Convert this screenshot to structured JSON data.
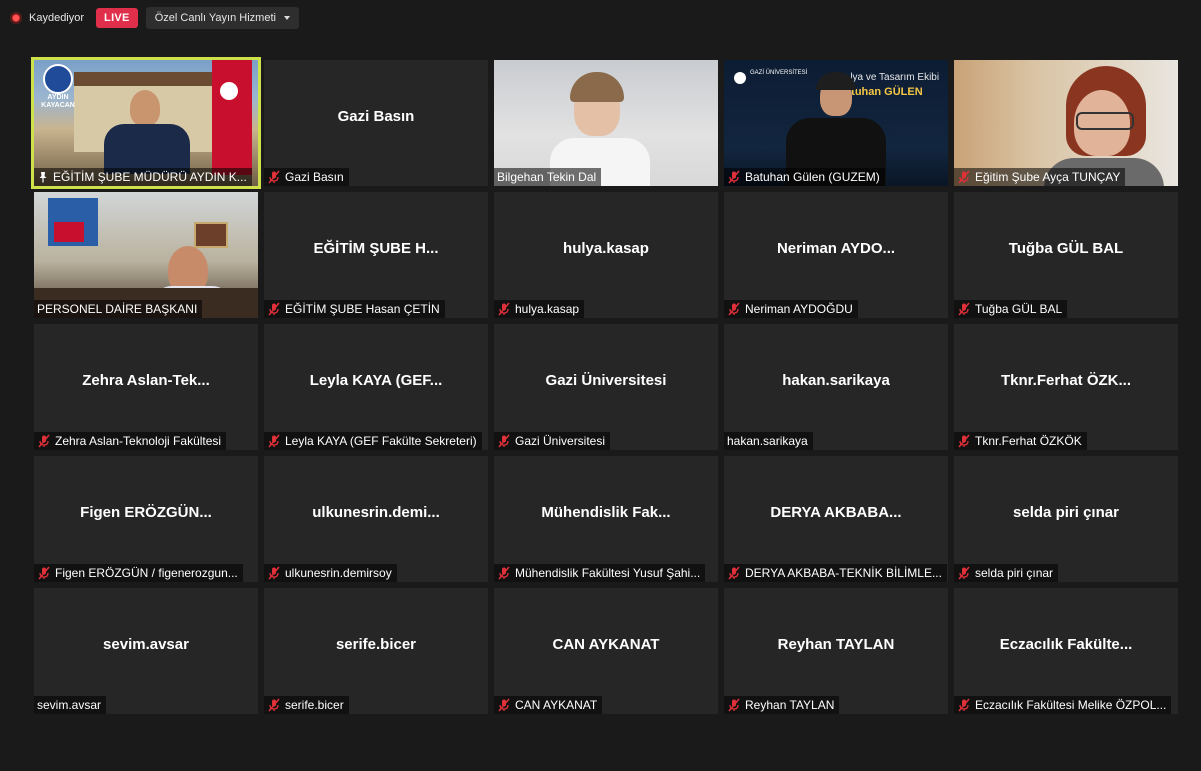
{
  "topbar": {
    "recording_label": "Kaydediyor",
    "live_label": "LIVE",
    "stream_service": "Özel Canlı Yayın Hizmeti"
  },
  "tiles": [
    {
      "name": "",
      "label": "EĞİTİM ŞUBE MÜDÜRÜ AYDIN K...",
      "video": true,
      "muted": false,
      "pinned": true,
      "active": true,
      "logo_text": "AYDIN KAYACAN"
    },
    {
      "name": "Gazi Basın",
      "label": "Gazi Basın",
      "video": false,
      "muted": true
    },
    {
      "name": "",
      "label": "Bilgehan Tekin Dal",
      "video": true,
      "muted": false
    },
    {
      "name": "",
      "label": "Batuhan Gülen (GUZEM)",
      "video": true,
      "muted": true,
      "banner_text": "...lya ve Tasarım Ekibi",
      "banner_name": "...tuhan GÜLEN",
      "banner_org": "GAZİ ÜNİVERSİTESİ"
    },
    {
      "name": "",
      "label": "Eğitim Şube Ayça TUNÇAY",
      "video": true,
      "muted": true
    },
    {
      "name": "",
      "label": "PERSONEL DAİRE BAŞKANI",
      "video": true,
      "muted": false
    },
    {
      "name": "EĞİTİM ŞUBE H...",
      "label": "EĞİTİM ŞUBE Hasan ÇETİN",
      "video": false,
      "muted": true
    },
    {
      "name": "hulya.kasap",
      "label": "hulya.kasap",
      "video": false,
      "muted": true
    },
    {
      "name": "Neriman  AYDO...",
      "label": "Neriman AYDOĞDU",
      "video": false,
      "muted": true
    },
    {
      "name": "Tuğba GÜL BAL",
      "label": "Tuğba GÜL BAL",
      "video": false,
      "muted": true
    },
    {
      "name": "Zehra  Aslan-Tek...",
      "label": "Zehra Aslan-Teknoloji Fakültesi",
      "video": false,
      "muted": true
    },
    {
      "name": "Leyla KAYA (GEF...",
      "label": "Leyla KAYA (GEF Fakülte Sekreteri)",
      "video": false,
      "muted": true
    },
    {
      "name": "Gazi Üniversitesi",
      "label": "Gazi Üniversitesi",
      "video": false,
      "muted": true
    },
    {
      "name": "hakan.sarikaya",
      "label": "hakan.sarikaya",
      "video": false,
      "muted": false
    },
    {
      "name": "Tknr.Ferhat  ÖZK...",
      "label": "Tknr.Ferhat ÖZKÖK",
      "video": false,
      "muted": true
    },
    {
      "name": "Figen  ERÖZGÜN...",
      "label": "Figen ERÖZGÜN / figenerozgun...",
      "video": false,
      "muted": true
    },
    {
      "name": "ulkunesrin.demi...",
      "label": "ulkunesrin.demirsoy",
      "video": false,
      "muted": true
    },
    {
      "name": "Mühendislik  Fak...",
      "label": "Mühendislik Fakültesi Yusuf Şahi...",
      "video": false,
      "muted": true
    },
    {
      "name": "DERYA AKBABA...",
      "label": "DERYA AKBABA-TEKNİK BİLİMLE...",
      "video": false,
      "muted": true
    },
    {
      "name": "selda piri çınar",
      "label": "selda piri çınar",
      "video": false,
      "muted": true
    },
    {
      "name": "sevim.avsar",
      "label": "sevim.avsar",
      "video": false,
      "muted": false
    },
    {
      "name": "serife.bicer",
      "label": "serife.bicer",
      "video": false,
      "muted": true
    },
    {
      "name": "CAN AYKANAT",
      "label": "CAN AYKANAT",
      "video": false,
      "muted": true
    },
    {
      "name": "Reyhan TAYLAN",
      "label": "Reyhan TAYLAN",
      "video": false,
      "muted": true
    },
    {
      "name": "Eczacılık  Fakülte...",
      "label": "Eczacılık Fakültesi Melike ÖZPOL...",
      "video": false,
      "muted": true
    }
  ],
  "icons": {
    "muted": "mic-off-icon",
    "pinned": "pin-icon",
    "recording": "record-dot-icon"
  },
  "colors": {
    "live": "#e02f4a",
    "active_speaker": "#cfe14a",
    "mute": "#e0303a"
  }
}
